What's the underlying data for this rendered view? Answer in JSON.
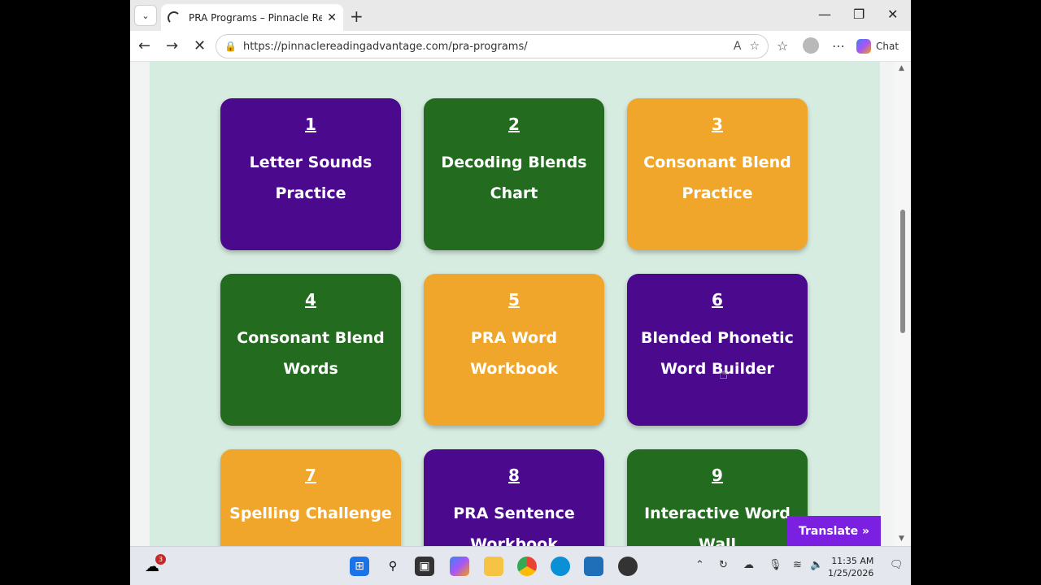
{
  "browser": {
    "tab_title": "PRA Programs – Pinnacle Reading",
    "url": "https://pinnaclereadingadvantage.com/pra-programs/",
    "chat_label": "Chat"
  },
  "page": {
    "cards": [
      {
        "num": "1",
        "label": "Letter Sounds Practice",
        "color": "#4b0a8e"
      },
      {
        "num": "2",
        "label": "Decoding Blends Chart",
        "color": "#236b1f"
      },
      {
        "num": "3",
        "label": "Consonant Blend Practice",
        "color": "#f0a62a"
      },
      {
        "num": "4",
        "label": "Consonant Blend Words",
        "color": "#236b1f"
      },
      {
        "num": "5",
        "label": "PRA Word Workbook",
        "color": "#f0a62a"
      },
      {
        "num": "6",
        "label": "Blended Phonetic Word Builder",
        "color": "#4b0a8e"
      },
      {
        "num": "7",
        "label": "Spelling Challenge",
        "color": "#f0a62a"
      },
      {
        "num": "8",
        "label": "PRA Sentence Workbook",
        "color": "#4b0a8e"
      },
      {
        "num": "9",
        "label": "Interactive Word Wall",
        "color": "#236b1f"
      }
    ],
    "translate_label": "Translate »"
  },
  "taskbar": {
    "weather_badge": "3",
    "time": "11:35 AM",
    "date": "1/25/2026"
  }
}
